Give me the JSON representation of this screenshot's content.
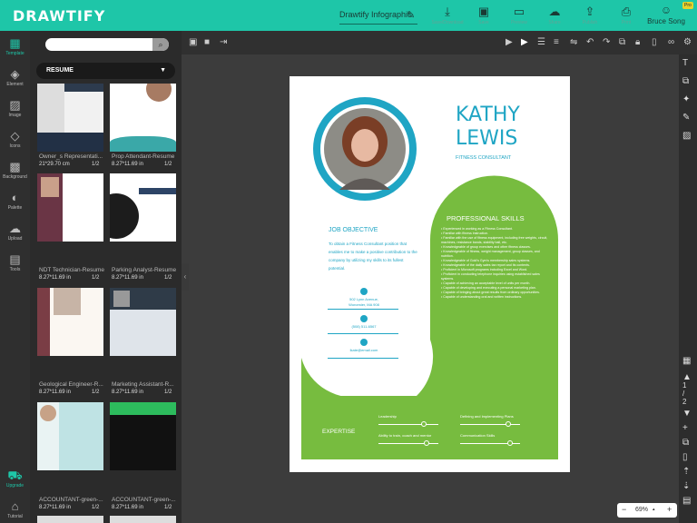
{
  "app": {
    "logo": "DRAWTIFY",
    "doc_title": "Drawtify Infographic",
    "user_name": "Bruce Song",
    "pro_badge": "Pro",
    "accent": "#1ec6a8"
  },
  "toolbar": {
    "labels": [
      "Save/Download",
      "Save",
      "Preview",
      "Share",
      "Publish",
      "Print"
    ]
  },
  "sidebar": {
    "items": [
      {
        "label": "Template",
        "icon": "template-icon",
        "active": true
      },
      {
        "label": "Element",
        "icon": "element-icon"
      },
      {
        "label": "Image",
        "icon": "image-icon"
      },
      {
        "label": "Icons",
        "icon": "icons-icon"
      },
      {
        "label": "Background",
        "icon": "background-icon"
      },
      {
        "label": "Palette",
        "icon": "palette-icon"
      },
      {
        "label": "Upload",
        "icon": "upload-icon"
      },
      {
        "label": "Tools",
        "icon": "tools-icon"
      },
      {
        "label": "Upgrade",
        "icon": "cart-icon"
      },
      {
        "label": "Tutorial",
        "icon": "tutorial-icon"
      }
    ]
  },
  "templates": {
    "category": "RESUME",
    "search_placeholder": "",
    "items": [
      {
        "name": "Owner_s Representati...",
        "size": "21*29.70 cm",
        "pages": "1/2"
      },
      {
        "name": "Prop Attendant-Resume",
        "size": "8.27*11.69 in",
        "pages": "1/2"
      },
      {
        "name": "NDT Technician-Resume",
        "size": "8.27*11.69 in",
        "pages": "1/2"
      },
      {
        "name": "Parking Analyst-Resume",
        "size": "8.27*11.69 in",
        "pages": "1/2"
      },
      {
        "name": "Geological Engineer-R...",
        "size": "8.27*11.69 in",
        "pages": "1/2"
      },
      {
        "name": "Marketing Assistant-R...",
        "size": "8.27*11.69 in",
        "pages": "1/2"
      },
      {
        "name": "ACCOUNTANT-green-...",
        "size": "8.27*11.69 in",
        "pages": "1/2"
      },
      {
        "name": "ACCOUNTANT-green-...",
        "size": "8.27*11.69 in",
        "pages": "1/2"
      }
    ]
  },
  "resume": {
    "first": "KATHY",
    "last": "LEWIS",
    "role": "FITNESS CONSULTANT",
    "objective_title": "JOB OBJECTIVE",
    "objective_text": "To obtain a Fitness Consultant position that enables me to make a positive contribution to the company by utilizing my skills to its fullest potential.",
    "address": "502 Lynn Avenue, Worcester, MA 908",
    "phone": "(508) 511-6567",
    "email": "lkate@email.com",
    "skills_title": "PROFESSIONAL SKILLS",
    "skills": [
      "Experienced in working as a Fitness Consultant.",
      "Familiar with fitness instruction.",
      "Familiar with the use of fitness equipment, including free weights, circuit, machines, resistance bands, stability ball, etc.",
      "Knowledgeable of group exercises and other fitness classes.",
      "Knowledgeable of fitness, weight management, group classes, and nutrition.",
      "Knowledgeable of Gold's Gym's membership sales systems.",
      "Knowledgeable of the daily sales tax report and its contents.",
      "Proficient in Microsoft programs including Excel and Word.",
      "Proficient in conducting telephone inquiries using established sales systems.",
      "Capable of achieving an acceptable level of units per month.",
      "Capable of developing and executing a personal marketing plan.",
      "Capable of bringing about great results from ordinary opportunities.",
      "Capable of understanding oral and written instructions."
    ],
    "expertise_title": "EXPERTISE",
    "expertise": [
      {
        "label": "Leadership",
        "level": 0.76
      },
      {
        "label": "Defining and Implementing Plans",
        "level": 0.8
      },
      {
        "label": "Ability to train, coach and mentor",
        "level": 0.8
      },
      {
        "label": "Communication Skills",
        "level": 0.84
      }
    ],
    "colors": {
      "teal": "#1fa5c4",
      "green": "#77bc3f"
    }
  },
  "paging": {
    "current": "1",
    "slash": "/",
    "total": "2"
  },
  "zoom": {
    "value": "69%"
  }
}
